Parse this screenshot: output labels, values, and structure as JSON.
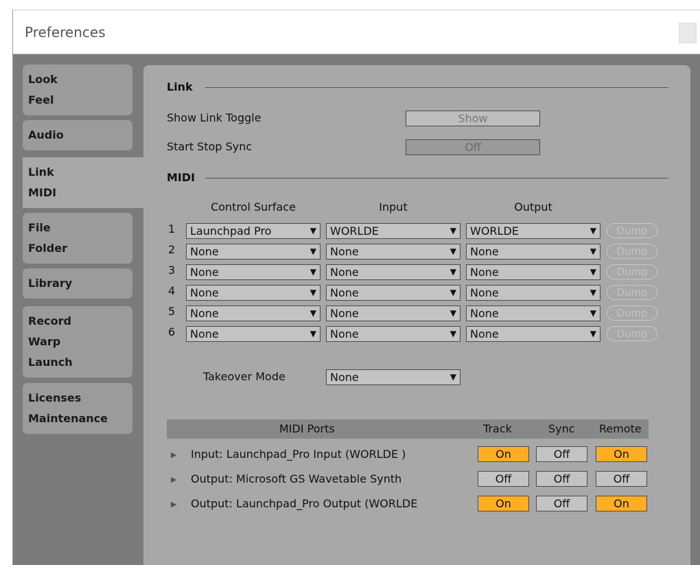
{
  "window": {
    "title": "Preferences"
  },
  "sidebar": {
    "tabs": [
      {
        "lines": [
          "Look",
          "Feel"
        ]
      },
      {
        "lines": [
          "Audio"
        ]
      },
      {
        "lines": [
          "Link",
          "MIDI"
        ]
      },
      {
        "lines": [
          "File",
          "Folder"
        ]
      },
      {
        "lines": [
          "Library"
        ]
      },
      {
        "lines": [
          "Record",
          "Warp",
          "Launch"
        ]
      },
      {
        "lines": [
          "Licenses",
          "Maintenance"
        ]
      }
    ],
    "active_index": 2
  },
  "link": {
    "section_title": "Link",
    "show_link_toggle_label": "Show Link Toggle",
    "show_link_toggle_value": "Show",
    "start_stop_sync_label": "Start Stop Sync",
    "start_stop_sync_value": "Off"
  },
  "midi": {
    "section_title": "MIDI",
    "columns": {
      "control_surface": "Control Surface",
      "input": "Input",
      "output": "Output"
    },
    "rows": [
      {
        "num": "1",
        "surface": "Launchpad Pro",
        "input": "WORLDE",
        "output": "WORLDE",
        "dump": "Dump"
      },
      {
        "num": "2",
        "surface": "None",
        "input": "None",
        "output": "None",
        "dump": "Dump"
      },
      {
        "num": "3",
        "surface": "None",
        "input": "None",
        "output": "None",
        "dump": "Dump"
      },
      {
        "num": "4",
        "surface": "None",
        "input": "None",
        "output": "None",
        "dump": "Dump"
      },
      {
        "num": "5",
        "surface": "None",
        "input": "None",
        "output": "None",
        "dump": "Dump"
      },
      {
        "num": "6",
        "surface": "None",
        "input": "None",
        "output": "None",
        "dump": "Dump"
      }
    ],
    "takeover_label": "Takeover Mode",
    "takeover_value": "None"
  },
  "ports": {
    "headers": {
      "ports": "MIDI Ports",
      "track": "Track",
      "sync": "Sync",
      "remote": "Remote"
    },
    "rows": [
      {
        "label": "Input:   Launchpad_Pro Input (WORLDE  )",
        "track": "On",
        "sync": "Off",
        "remote": "On"
      },
      {
        "label": "Output:  Microsoft GS Wavetable Synth",
        "track": "Off",
        "sync": "Off",
        "remote": "Off"
      },
      {
        "label": "Output:  Launchpad_Pro Output (WORLDE",
        "track": "On",
        "sync": "Off",
        "remote": "On"
      }
    ]
  },
  "colors": {
    "on": "#ffad23",
    "panel": "#a8a8a8",
    "background": "#7b7b7b"
  },
  "icons": {
    "dropdown": "triangle-down-icon",
    "expand": "triangle-right-icon"
  }
}
